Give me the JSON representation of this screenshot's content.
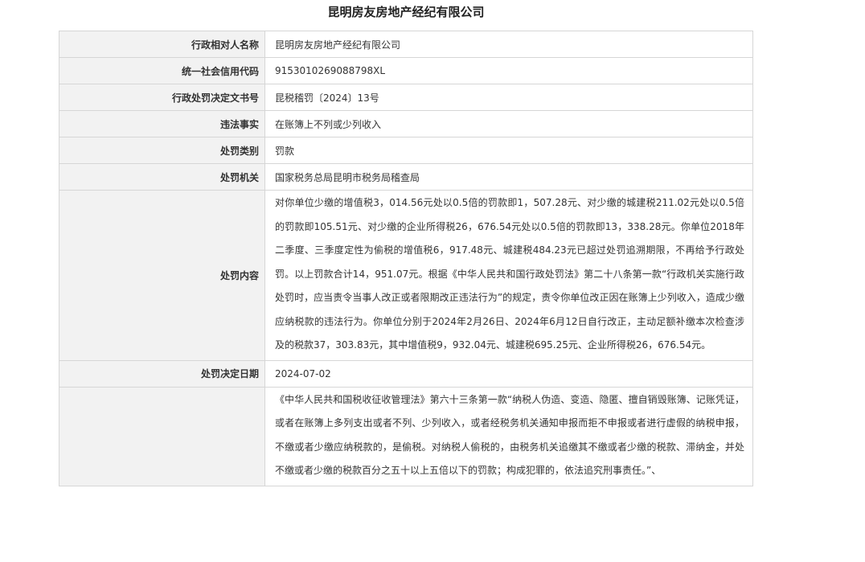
{
  "page": {
    "title": "昆明房友房地产经纪有限公司"
  },
  "rows": [
    {
      "label": "行政相对人名称",
      "value": "昆明房友房地产经纪有限公司"
    },
    {
      "label": "统一社会信用代码",
      "value": "9153010269088798XL"
    },
    {
      "label": "行政处罚决定文书号",
      "value": "昆税稽罚〔2024〕13号"
    },
    {
      "label": "违法事实",
      "value": "在账簿上不列或少列收入"
    },
    {
      "label": "处罚类别",
      "value": "罚款"
    },
    {
      "label": "处罚机关",
      "value": "国家税务总局昆明市税务局稽查局"
    }
  ],
  "content": {
    "label": "处罚内容",
    "text": "对你单位少缴的增值税3，014.56元处以0.5倍的罚款即1，507.28元、对少缴的城建税211.02元处以0.5倍的罚款即105.51元、对少缴的企业所得税26，676.54元处以0.5倍的罚款即13，338.28元。你单位2018年二季度、三季度定性为偷税的增值税6，917.48元、城建税484.23元已超过处罚追溯期限，不再给予行政处罚。以上罚款合计14，951.07元。根据《中华人民共和国行政处罚法》第二十八条第一款“行政机关实施行政处罚时，应当责令当事人改正或者限期改正违法行为”的规定，责令你单位改正因在账簿上少列收入，造成少缴应纳税款的违法行为。你单位分别于2024年2月26日、2024年6月12日自行改正，主动足额补缴本次检查涉及的税款37，303.83元，其中增值税9，932.04元、城建税695.25元、企业所得税26，676.54元。"
  },
  "decision_date": {
    "label": "处罚决定日期",
    "value": "2024-07-02"
  },
  "basis": {
    "label": "",
    "text": "《中华人民共和国税收征收管理法》第六十三条第一款“纳税人伪造、变造、隐匿、擅自销毁账簿、记账凭证，或者在账簿上多列支出或者不列、少列收入，或者经税务机关通知申报而拒不申报或者进行虚假的纳税申报，不缴或者少缴应纳税款的，是偷税。对纳税人偷税的，由税务机关追缴其不缴或者少缴的税款、滞纳金，并处不缴或者少缴的税款百分之五十以上五倍以下的罚款；构成犯罪的，依法追究刑事责任。”、"
  }
}
